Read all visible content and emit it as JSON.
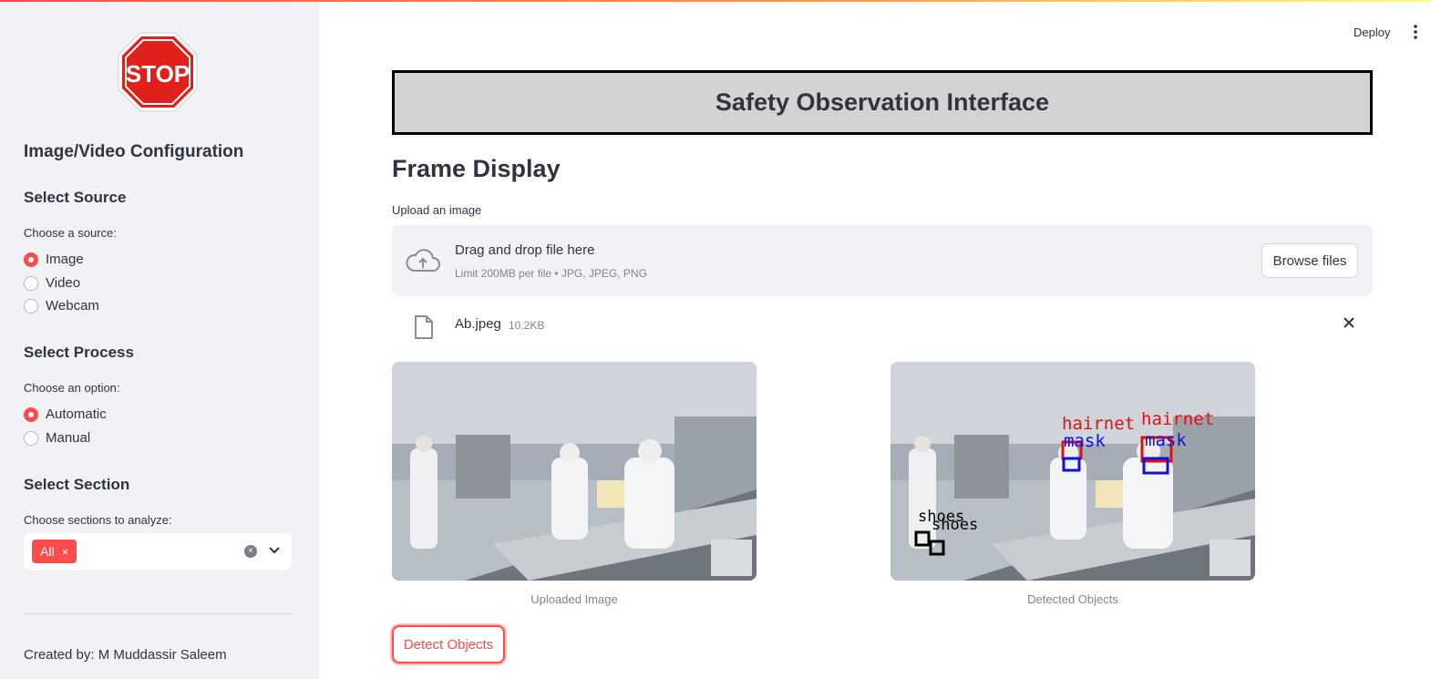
{
  "sidebar": {
    "logo_text": "STOP",
    "config_title": "Image/Video Configuration",
    "source": {
      "heading": "Select Source",
      "label": "Choose a source:",
      "options": [
        "Image",
        "Video",
        "Webcam"
      ],
      "selected": "Image"
    },
    "process": {
      "heading": "Select Process",
      "label": "Choose an option:",
      "options": [
        "Automatic",
        "Manual"
      ],
      "selected": "Automatic"
    },
    "section": {
      "heading": "Select Section",
      "label": "Choose sections to analyze:",
      "tags": [
        "All"
      ],
      "tag_remove": "×",
      "clear": "×"
    },
    "credit": "Created by: M Muddassir Saleem"
  },
  "header": {
    "deploy_label": "Deploy"
  },
  "main": {
    "banner_title": "Safety Observation Interface",
    "frame_heading": "Frame Display",
    "uploader": {
      "label": "Upload an image",
      "dropzone_title": "Drag and drop file here",
      "dropzone_hint": "Limit 200MB per file • JPG, JPEG, PNG",
      "browse_label": "Browse files"
    },
    "file": {
      "name": "Ab.jpeg",
      "size": "10.2KB"
    },
    "images": {
      "uploaded_caption": "Uploaded Image",
      "detected_caption": "Detected Objects",
      "detections": {
        "hairnet": "hairnet",
        "mask": "mask",
        "shoes": "shoes"
      }
    },
    "detect_button": "Detect Objects"
  },
  "colors": {
    "accent": "#ff4b4b",
    "sidebar_bg": "#f0f2f6",
    "banner_bg": "#d3d3d3",
    "text": "#31333f",
    "muted": "#808495"
  }
}
